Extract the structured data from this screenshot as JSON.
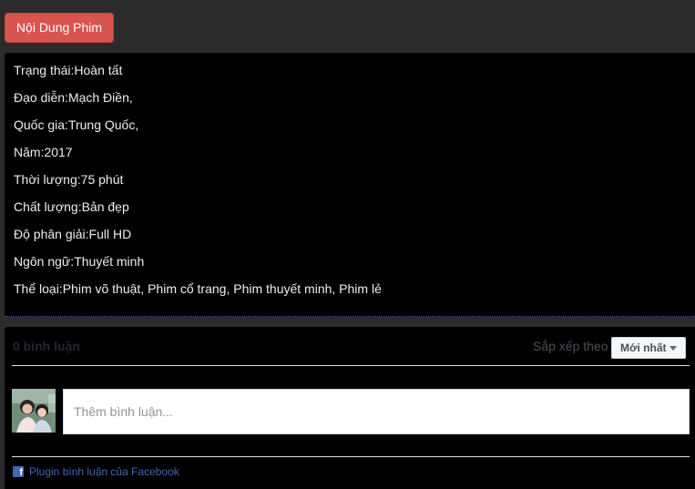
{
  "tab": {
    "label": "Nội Dung Phim",
    "color": "#d9534f"
  },
  "info": [
    {
      "label": "Trạng thái:",
      "value": "Hoàn tất"
    },
    {
      "label": "Đạo diễn:",
      "value": "Mạch Điền,"
    },
    {
      "label": "Quốc gia:",
      "value": "Trung Quốc,"
    },
    {
      "label": "Năm:",
      "value": "2017"
    },
    {
      "label": "Thời lượng:",
      "value": "75 phút"
    },
    {
      "label": "Chất lượng:",
      "value": "Bản đẹp"
    },
    {
      "label": "Độ phân giải:",
      "value": "Full HD"
    },
    {
      "label": "Ngôn ngữ:",
      "value": "Thuyết minh"
    },
    {
      "label": "Thể loại:",
      "value": "Phim võ thuật, Phim cổ trang, Phim thuyết minh, Phim lẻ"
    }
  ],
  "comments": {
    "count_label": "0 bình luận",
    "sort_label": "Sắp xếp theo",
    "sort_selected": "Mới nhất",
    "input_placeholder": "Thêm bình luận...",
    "plugin_label": "Plugin bình luận của Facebook",
    "plugin_icon": "facebook-icon",
    "plugin_color": "#4267b2"
  }
}
